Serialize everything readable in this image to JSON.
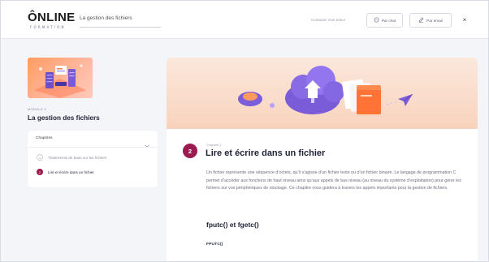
{
  "header": {
    "logo_text": "ÔNLINE",
    "logo_subtext": "FORMATION",
    "course_title": "La gestion des fichiers",
    "contact_label": "Contacter mon tuteur",
    "chat_button": "Par chat",
    "email_button": "Par email",
    "close_icon": "close-icon"
  },
  "sidebar": {
    "module_label": "MODULE 5",
    "module_title": "La gestion des fichiers",
    "chapters_heading": "Chapitres",
    "chapters": [
      {
        "num": "1",
        "label": "Traitements de base sur les fichiers",
        "active": false
      },
      {
        "num": "2",
        "label": "Lire et écrire dans un fichier",
        "active": true
      }
    ]
  },
  "main": {
    "chapter_number": "2",
    "chapter_label": "Chapitre 2",
    "chapter_title": "Lire et écrire dans un fichier",
    "paragraph": "Un fichier représente une séquence d’octets, qu’il s’agisse d’un fichier texte ou d’un fichier binaire. Le langage de programmation C permet d’accéder aux fonctions de haut niveau ainsi qu’aux appels de bas niveau (au niveau du système d’exploitation) pour gérer les fichiers sur vos périphériques de stockage. Ce chapitre vous guidera à travers les appels importants pour la gestion de fichiers.",
    "section_heading": "fputc() et fgetc()",
    "subheading": "FPUTC()"
  },
  "colors": {
    "accent": "#9b1a4f",
    "hero_bg": "#f8d3bd",
    "page_bg": "#f4f5f9"
  }
}
